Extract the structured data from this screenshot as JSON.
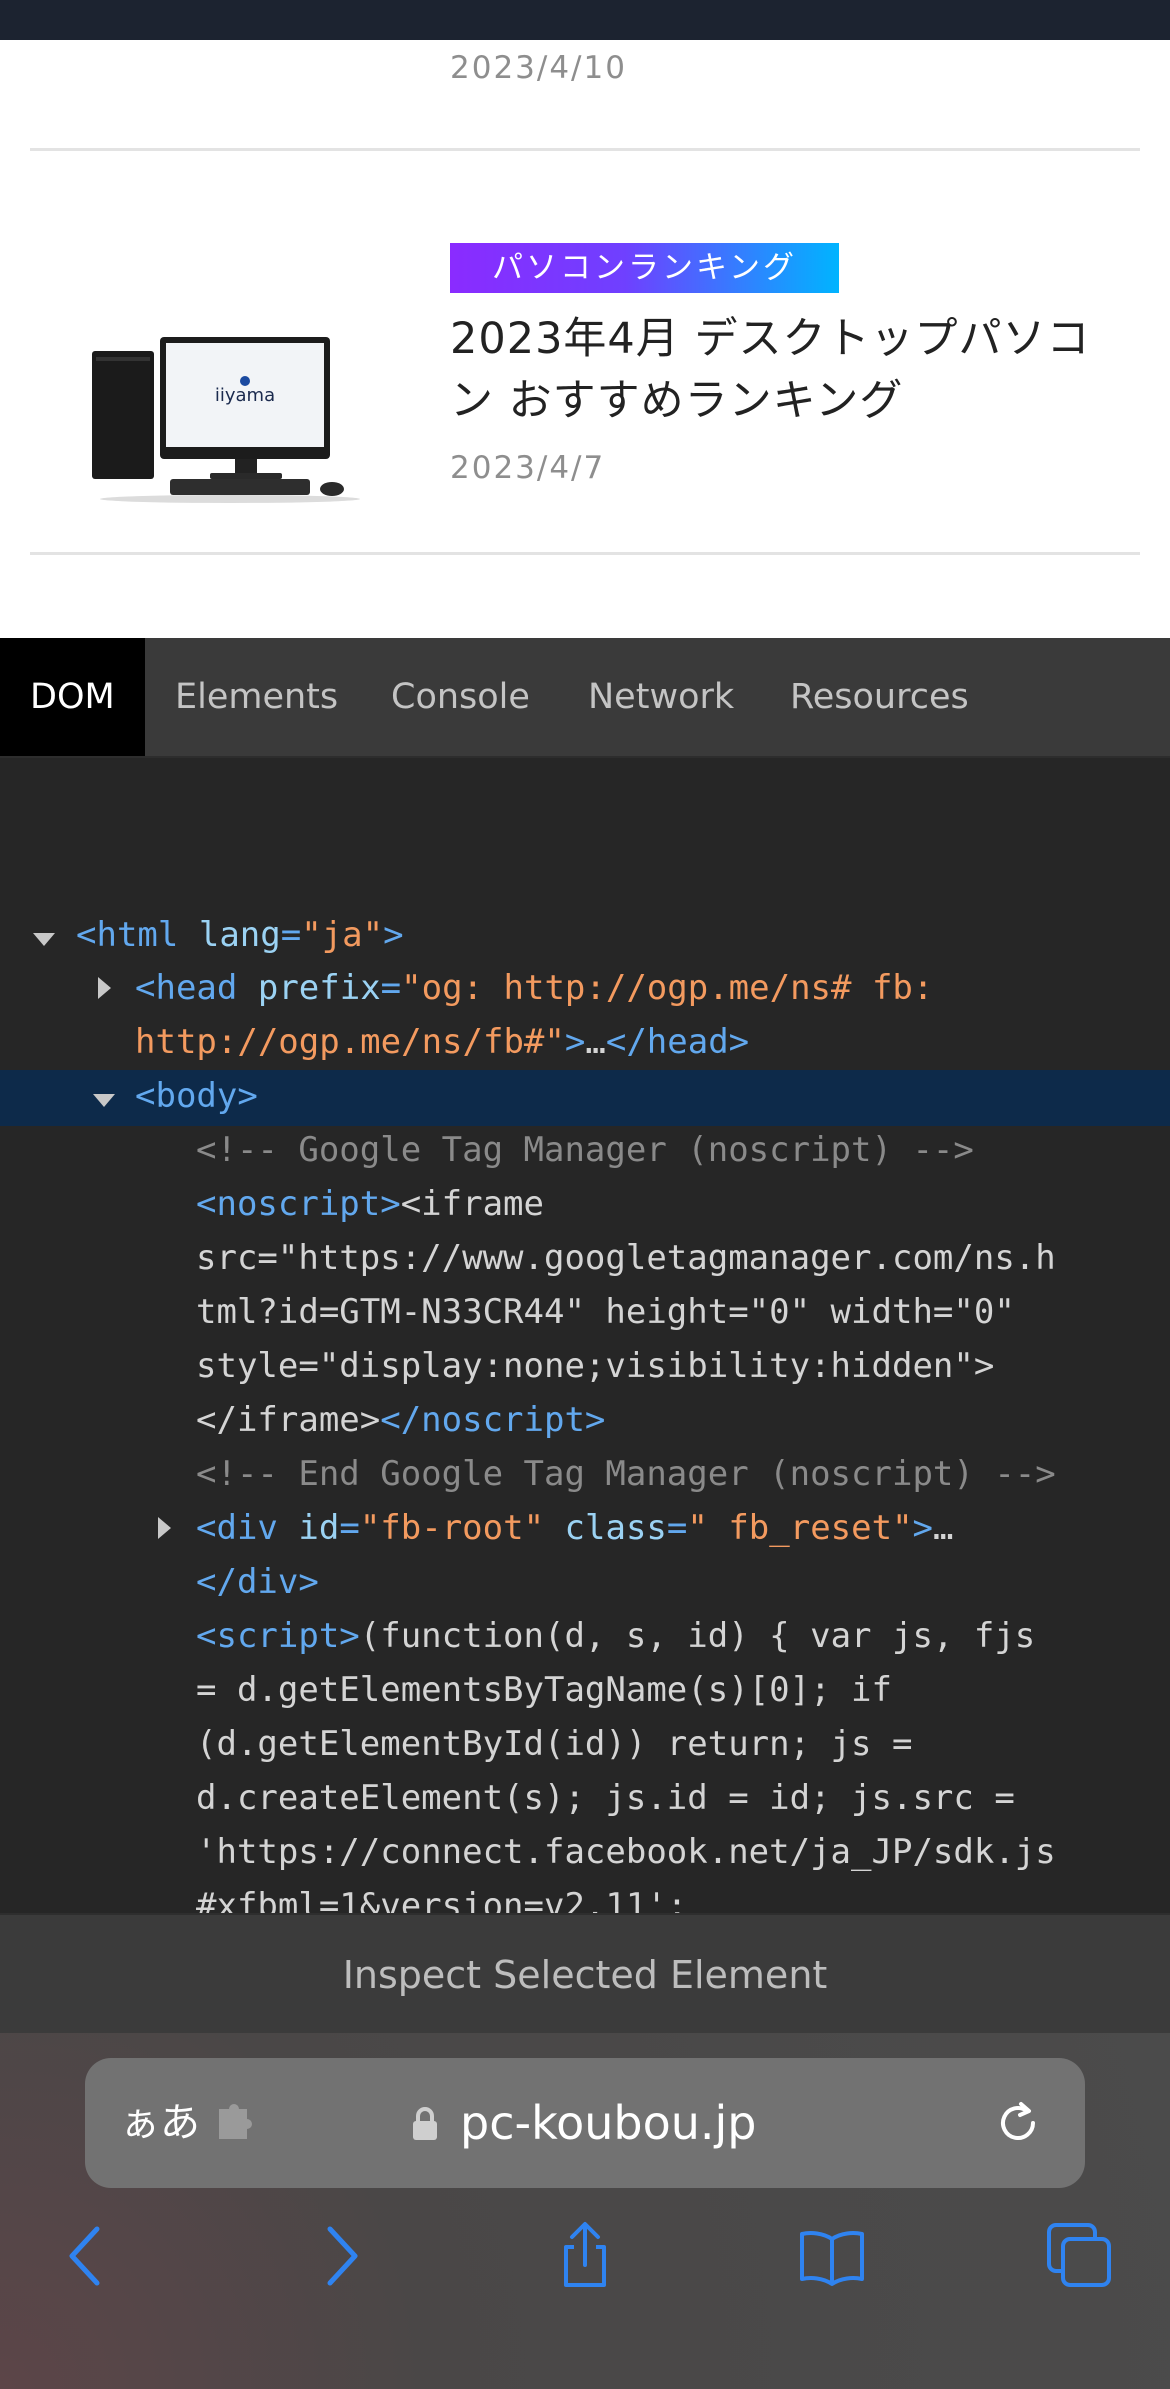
{
  "webpage": {
    "prev_article_date": "2023/4/10",
    "article": {
      "category": "パソコンランキング",
      "title": "2023年4月 デスクトップパソコン おすすめランキング",
      "date": "2023/4/7",
      "thumbnail_brand": "iiyama"
    }
  },
  "devtools": {
    "tabs": [
      "DOM",
      "Elements",
      "Console",
      "Network",
      "Resources"
    ],
    "active_tab": "DOM",
    "inspect_button": "Inspect Selected Element"
  },
  "browser": {
    "text_size_label": "ぁあ",
    "domain": "pc-koubou.jp",
    "icons": [
      "extension-icon",
      "lock-icon",
      "reload-icon",
      "back-icon",
      "forward-icon",
      "share-icon",
      "bookmarks-icon",
      "tabs-icon"
    ]
  },
  "colors": {
    "accent_blue": "#2f83f0",
    "selection": "#0d2a4a",
    "badge_start": "#8a2bff",
    "badge_end": "#00b4ff"
  }
}
